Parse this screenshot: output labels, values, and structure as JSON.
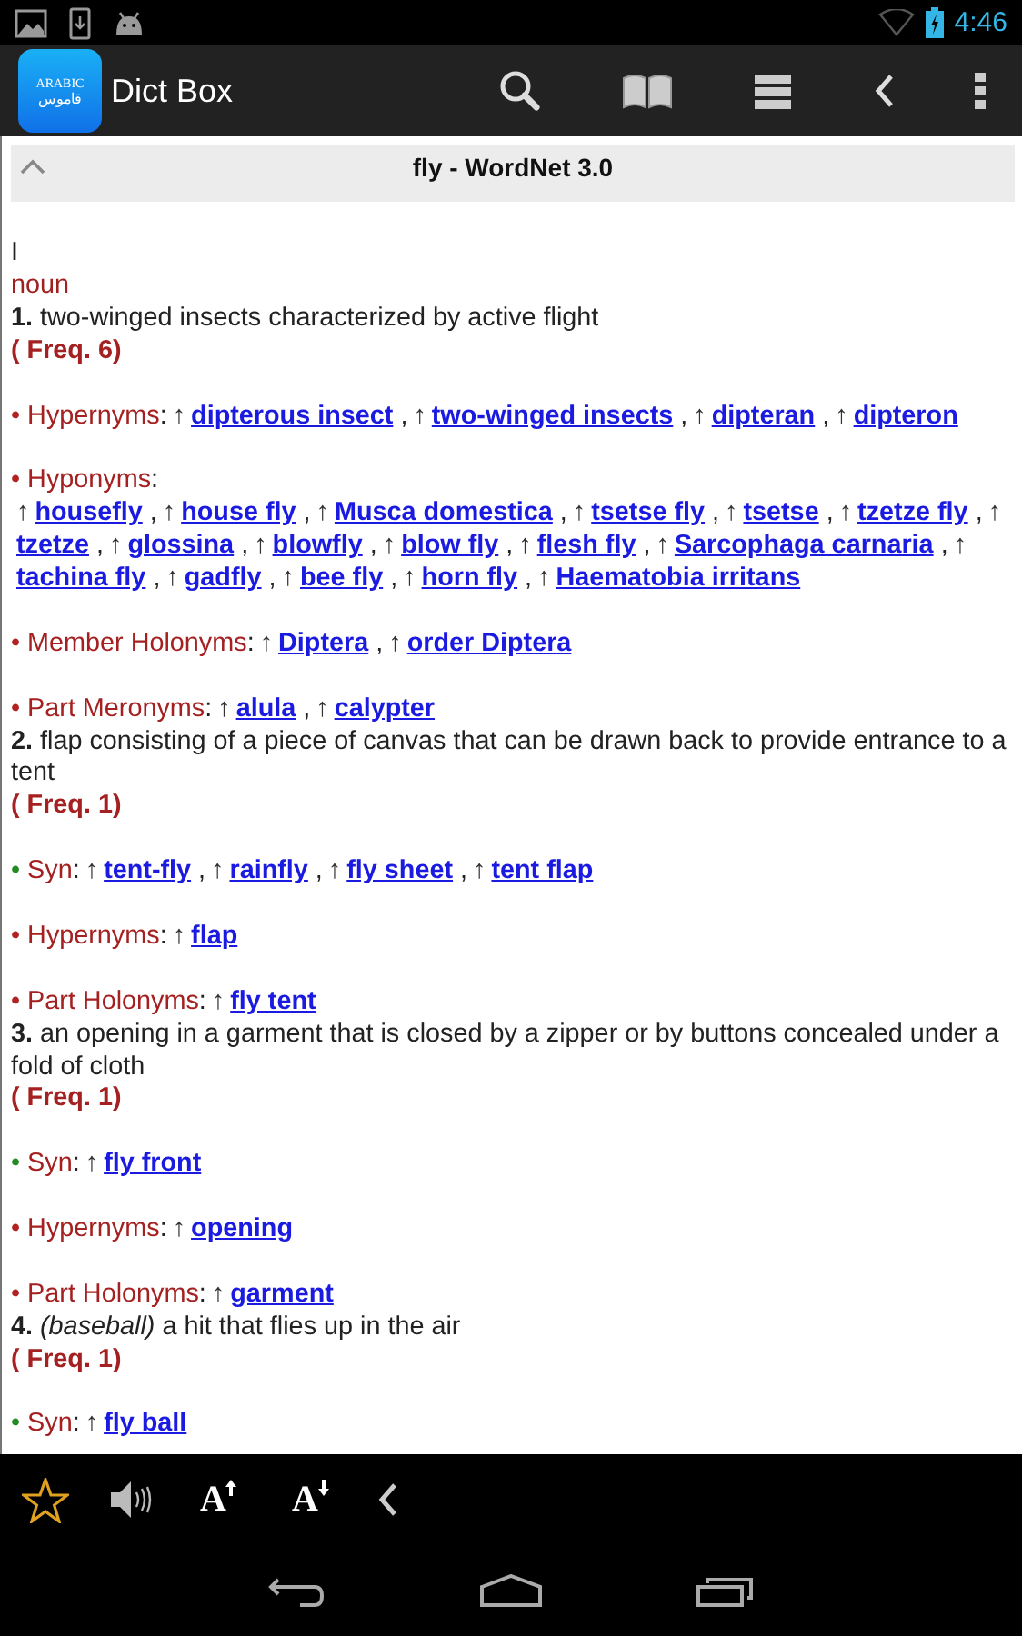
{
  "status_bar": {
    "time": "4:46"
  },
  "app_bar": {
    "logo": {
      "top": "ARABIC",
      "bottom": "قاموس"
    },
    "title": "Dict Box"
  },
  "entry_header": {
    "title": "fly - WordNet 3.0",
    "expanded": true
  },
  "entry": {
    "roman": "I",
    "pos": "noun",
    "senses": [
      {
        "number": "1.",
        "gloss": "two-winged insects characterized by active flight",
        "freq": "( Freq. 6)",
        "relations": [
          {
            "bullet": "•",
            "color": "#b22222",
            "label": "Hypernyms",
            "newline": false,
            "terms": [
              {
                "mark": "↑",
                "word": "dipterous insect",
                "after": ","
              },
              {
                "mark": "↑",
                "word": "two-winged insects",
                "after": ","
              },
              {
                "mark": "↑",
                "word": "dipteran",
                "after": ","
              },
              {
                "mark": "↑",
                "word": "dipteron"
              }
            ]
          },
          {
            "bullet": "•",
            "color": "#b22222",
            "label": "Hyponyms",
            "newline": true,
            "terms": [
              {
                "mark": "↑",
                "word": "housefly",
                "after": ","
              },
              {
                "mark": "↑",
                "word": "house fly",
                "after": ","
              },
              {
                "mark": "↑",
                "word": "Musca domestica",
                "after": ","
              },
              {
                "mark": "↑",
                "word": "tsetse fly",
                "after": ","
              },
              {
                "mark": "↑",
                "word": "tsetse",
                "after": ","
              },
              {
                "mark": "↑",
                "word": "tzetze fly",
                "after": ","
              },
              {
                "mark": "↑",
                "word": "tzetze",
                "after": ","
              },
              {
                "mark": "↑",
                "word": "glossina",
                "after": ","
              },
              {
                "mark": "↑",
                "word": "blowfly",
                "after": ","
              },
              {
                "mark": "↑",
                "word": "blow fly",
                "after": ","
              },
              {
                "mark": "↑",
                "word": "flesh fly",
                "after": ","
              },
              {
                "mark": "↑",
                "word": "Sarcophaga carnaria",
                "after": ","
              },
              {
                "mark": "↑",
                "word": "tachina fly",
                "after": ","
              },
              {
                "mark": "↑",
                "word": "gadfly",
                "after": ","
              },
              {
                "mark": "↑",
                "word": "bee fly",
                "after": ","
              },
              {
                "mark": "↑",
                "word": "horn fly",
                "after": ","
              },
              {
                "mark": "↑",
                "word": "Haematobia irritans"
              }
            ]
          },
          {
            "bullet": "•",
            "color": "#b22222",
            "label": "Member Holonyms",
            "newline": false,
            "terms": [
              {
                "mark": "↑",
                "word": "Diptera",
                "after": ","
              },
              {
                "mark": "↑",
                "word": "order Diptera"
              }
            ]
          },
          {
            "bullet": "•",
            "color": "#b22222",
            "label": "Part Meronyms",
            "newline": false,
            "terms": [
              {
                "mark": "↑",
                "word": "alula",
                "after": ","
              },
              {
                "mark": "↑",
                "word": "calypter"
              }
            ]
          }
        ]
      },
      {
        "number": "2.",
        "gloss": "flap consisting of a piece of canvas that can be drawn back to provide entrance to a tent",
        "freq": "( Freq. 1)",
        "relations": [
          {
            "bullet": "•",
            "color": "#228b22",
            "label": "Syn",
            "newline": false,
            "terms": [
              {
                "mark": "↑",
                "word": "tent-fly",
                "after": ","
              },
              {
                "mark": "↑",
                "word": "rainfly",
                "after": ","
              },
              {
                "mark": "↑",
                "word": "fly sheet",
                "after": ","
              },
              {
                "mark": "↑",
                "word": "tent flap"
              }
            ]
          },
          {
            "bullet": "•",
            "color": "#b22222",
            "label": "Hypernyms",
            "newline": false,
            "terms": [
              {
                "mark": "↑",
                "word": "flap"
              }
            ]
          },
          {
            "bullet": "•",
            "color": "#b22222",
            "label": "Part Holonyms",
            "newline": false,
            "terms": [
              {
                "mark": "↑",
                "word": "fly tent"
              }
            ]
          }
        ]
      },
      {
        "number": "3.",
        "gloss": "an opening in a garment that is closed by a zipper or by buttons concealed under a fold of cloth",
        "freq": "( Freq. 1)",
        "relations": [
          {
            "bullet": "•",
            "color": "#228b22",
            "label": "Syn",
            "newline": false,
            "terms": [
              {
                "mark": "↑",
                "word": "fly front"
              }
            ]
          },
          {
            "bullet": "•",
            "color": "#b22222",
            "label": "Hypernyms",
            "newline": false,
            "terms": [
              {
                "mark": "↑",
                "word": "opening"
              }
            ]
          },
          {
            "bullet": "•",
            "color": "#b22222",
            "label": "Part Holonyms",
            "newline": false,
            "terms": [
              {
                "mark": "↑",
                "word": "garment"
              }
            ]
          }
        ]
      },
      {
        "number": "4.",
        "gloss": "*(baseball)* a hit that flies up in the air",
        "freq": "( Freq. 1)",
        "relations": [
          {
            "bullet": "•",
            "color": "#228b22",
            "label": "Syn",
            "newline": false,
            "terms": [
              {
                "mark": "↑",
                "word": "fly ball"
              }
            ]
          }
        ]
      }
    ]
  },
  "label_colon": ":",
  "bottom_toolbar": [
    {
      "kind": "star"
    },
    {
      "kind": "speaker"
    },
    {
      "kind": "font_up",
      "glyph": "A"
    },
    {
      "kind": "font_down",
      "glyph": "A"
    },
    {
      "kind": "back"
    }
  ]
}
